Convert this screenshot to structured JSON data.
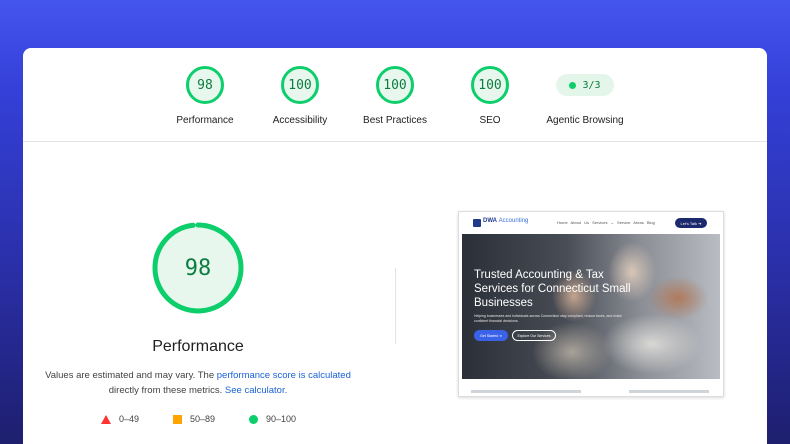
{
  "summary_scores": [
    {
      "label": "Performance",
      "score": "98"
    },
    {
      "label": "Accessibility",
      "score": "100"
    },
    {
      "label": "Best Practices",
      "score": "100"
    },
    {
      "label": "SEO",
      "score": "100"
    }
  ],
  "agentic": {
    "label": "Agentic Browsing",
    "value": "3/3"
  },
  "main": {
    "score": "98",
    "score_fraction": 0.98,
    "title": "Performance",
    "desc_prefix": "Values are estimated and may vary. The ",
    "desc_link1": "performance score is calculated",
    "desc_middle": " directly from these metrics. ",
    "desc_link2": "See calculator."
  },
  "legend": [
    {
      "shape": "triangle",
      "range": "0–49",
      "color": "#ff3333"
    },
    {
      "shape": "square",
      "range": "50–89",
      "color": "#ffa400"
    },
    {
      "shape": "circle",
      "range": "90–100",
      "color": "#0cce6b"
    }
  ],
  "colors": {
    "pass": "#0cce6b",
    "pass_text": "#0a7d3f",
    "link": "#1a62d6"
  },
  "screenshot": {
    "logo_text": "DWA",
    "logo_text2": "Accounting",
    "menu": "Home   About Us   Services ⌄   Service Areas   Blog",
    "cta": "Let's Talk ➔",
    "hero_title": "Trusted Accounting & Tax Services for Connecticut Small Businesses",
    "hero_sub": "Helping businesses and individuals across Connecticut stay compliant, reduce taxes, and make confident financial decisions.",
    "btn_primary": "Get Started ➔",
    "btn_secondary": "Explore Our Services"
  }
}
